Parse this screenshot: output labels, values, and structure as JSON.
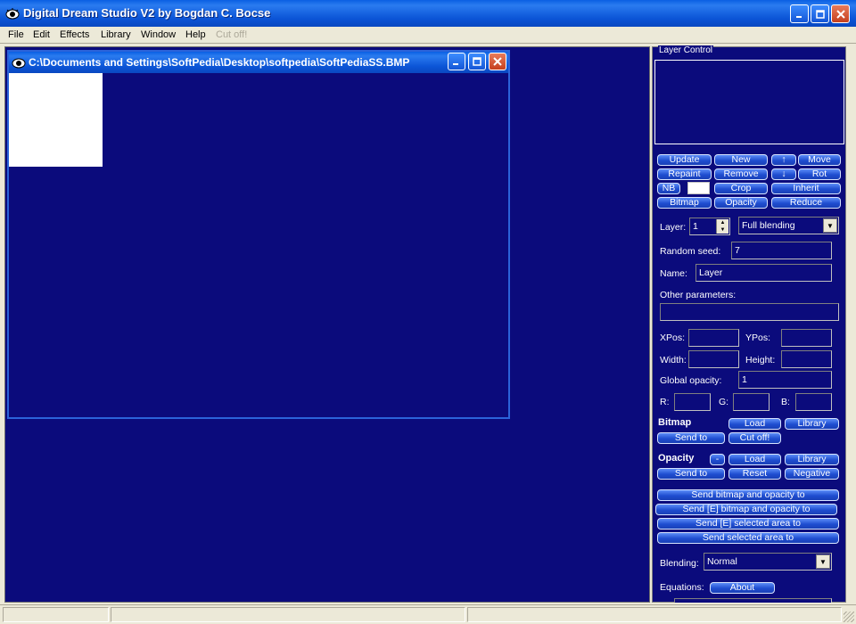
{
  "app": {
    "title": "Digital Dream Studio V2 by Bogdan C. Bocse",
    "icon": "eye-icon"
  },
  "menu": {
    "items": [
      "File",
      "Edit",
      "Effects",
      "Library",
      "Window",
      "Help",
      "Cut off!"
    ]
  },
  "document": {
    "title": "C:\\Documents and Settings\\SoftPedia\\Desktop\\softpedia\\SoftPediaSS.BMP"
  },
  "layer_control": {
    "label": "Layer Control",
    "buttons": {
      "update": "Update",
      "new": "New",
      "up": "↑",
      "move": "Move",
      "repaint": "Repaint",
      "remove": "Remove",
      "down": "↓",
      "rot": "Rot",
      "nb": "NB",
      "crop": "Crop",
      "inherit": "Inherit",
      "bitmap": "Bitmap",
      "opacity": "Opacity",
      "reduce": "Reduce"
    },
    "layer_label": "Layer:",
    "layer_value": "1",
    "blending_mode": "Full blending",
    "random_seed_label": "Random seed:",
    "random_seed_value": "7",
    "name_label": "Name:",
    "name_value": "Layer",
    "other_params_label": "Other parameters:",
    "xpos_label": "XPos:",
    "ypos_label": "YPos:",
    "width_label": "Width:",
    "height_label": "Height:",
    "global_opacity_label": "Global opacity:",
    "global_opacity_value": "1",
    "r_label": "R:",
    "g_label": "G:",
    "b_label": "B:"
  },
  "bitmap_section": {
    "heading": "Bitmap",
    "load": "Load",
    "library": "Library",
    "send_to": "Send to",
    "cut_off": "Cut off!"
  },
  "opacity_section": {
    "heading": "Opacity",
    "dropdown": "-",
    "load": "Load",
    "library": "Library",
    "send_to": "Send to",
    "reset": "Reset",
    "negative": "Negative"
  },
  "send_buttons": [
    "Send bitmap and opacity to",
    "Send [E] bitmap and opacity to",
    "Send [E] selected area to",
    "Send selected area to"
  ],
  "blending": {
    "label": "Blending:",
    "value": "Normal"
  },
  "equations": {
    "label": "Equations:",
    "about": "About"
  }
}
